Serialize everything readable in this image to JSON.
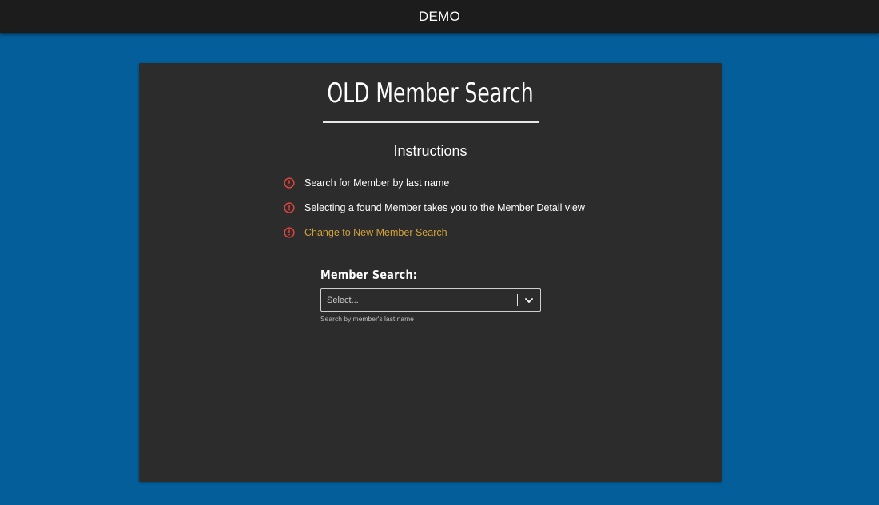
{
  "header": {
    "title": "DEMO"
  },
  "page": {
    "title": "OLD Member Search",
    "instructions_heading": "Instructions",
    "instructions": [
      {
        "text": "Search for Member by last name",
        "link": false
      },
      {
        "text": "Selecting a found Member takes you to the Member Detail view",
        "link": false
      },
      {
        "text": "Change to New Member Search",
        "link": true
      }
    ]
  },
  "search": {
    "label": "Member Search:",
    "placeholder": "Select...",
    "help_text": "Search by member's last name"
  },
  "colors": {
    "background": "#035e99",
    "topbar": "#1c1c1c",
    "card": "#2c2c2c",
    "alert_icon": "#e8453c",
    "link": "#d2a23a"
  },
  "icons": {
    "instruction_icon": "alert-circle-icon",
    "dropdown_icon": "chevron-down-icon"
  }
}
